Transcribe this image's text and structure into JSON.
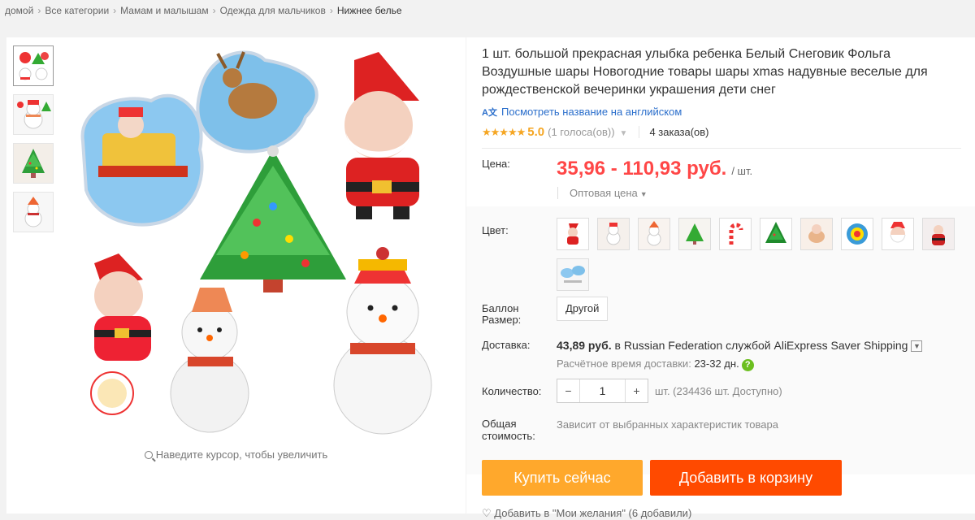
{
  "breadcrumb": [
    "домой",
    "Все категории",
    "Мамам и малышам",
    "Одежда для мальчиков",
    "Нижнее белье"
  ],
  "breadcrumb_sep": "›",
  "product": {
    "title": "1 шт. большой прекрасная улыбка ребенка Белый Снеговик Фольга Воздушные шары Новогодние товары шары xmas надувные веселые для рождественской вечеринки украшения дети снег",
    "translate_link": "Посмотреть название на английском",
    "translate_icon": "A文",
    "stars": "★★★★★",
    "rating": "5.0",
    "votes": "(1 голоса(ов))",
    "orders": "4 заказа(ов)"
  },
  "gallery": {
    "zoom_hint": "Наведите курсор, чтобы увеличить"
  },
  "price": {
    "label": "Цена:",
    "value": "35,96 - 110,93 руб.",
    "unit": "/ шт.",
    "wholesale": "Оптовая цена"
  },
  "options": {
    "color_label": "Цвет:",
    "color_count": 11,
    "size_label": "Баллон Размер:",
    "size_value": "Другой"
  },
  "shipping": {
    "label": "Доставка:",
    "price": "43,89 руб.",
    "text": "в Russian Federation службой AliExpress Saver Shipping",
    "estimate_label": "Расчётное время доставки:",
    "estimate_value": "23-32 дн."
  },
  "quantity": {
    "label": "Количество:",
    "value": "1",
    "minus": "−",
    "plus": "+",
    "available": "шт. (234436 шт. Доступно)"
  },
  "total": {
    "label": "Общая стоимость:",
    "text": "Зависит от выбранных характеристик товара"
  },
  "actions": {
    "buy_now": "Купить сейчас",
    "add_to_cart": "Добавить в корзину",
    "wishlist": "♡ Добавить в \"Мои желания\" (6 добавили)"
  },
  "colors": {
    "price": "#ff4747",
    "link": "#2a6ecb",
    "buy": "#ffa82c",
    "cart": "#ff4a00",
    "stars": "#f5a623"
  }
}
